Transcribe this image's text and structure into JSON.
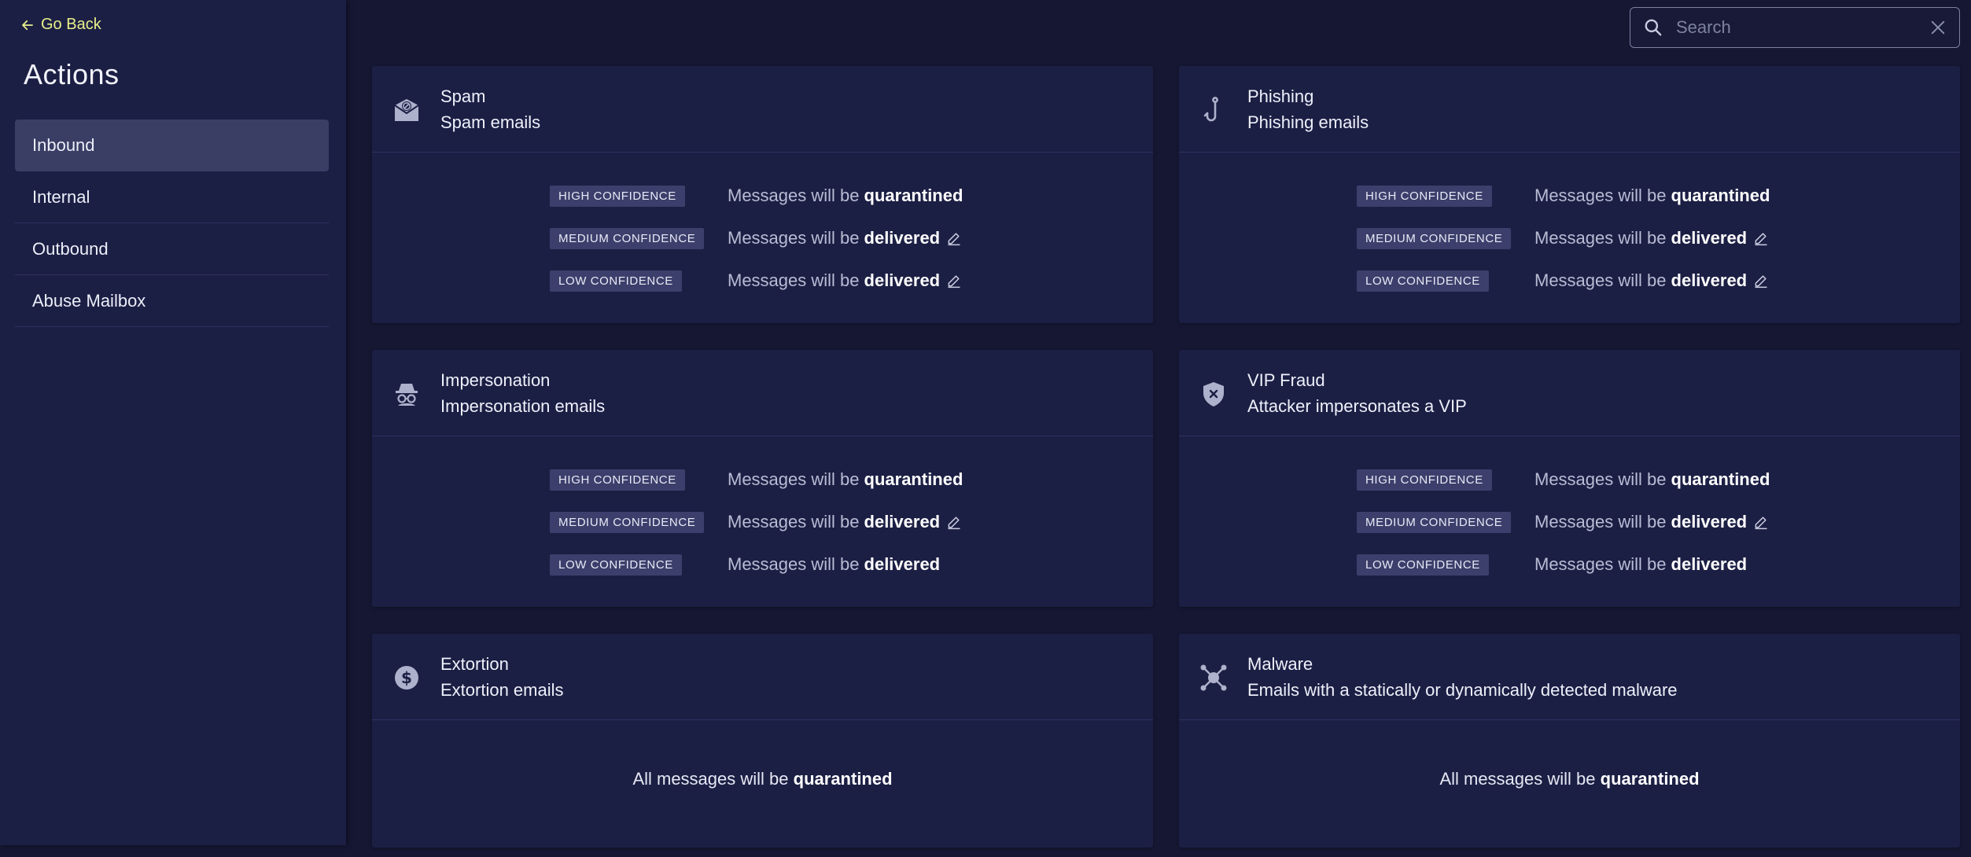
{
  "sidebar": {
    "go_back": "Go Back",
    "title": "Actions",
    "items": [
      {
        "label": "Inbound",
        "active": true
      },
      {
        "label": "Internal",
        "active": false
      },
      {
        "label": "Outbound",
        "active": false
      },
      {
        "label": "Abuse Mailbox",
        "active": false
      }
    ]
  },
  "search": {
    "placeholder": "Search",
    "value": ""
  },
  "colors": {
    "background": "#161733",
    "panel": "#1c1f44",
    "accent": "#e7ef8a",
    "badge": "#3c3f6b"
  },
  "cards": {
    "spam": {
      "icon": "envelope-ban-icon",
      "name": "Spam",
      "subtitle": "Spam emails",
      "rows": [
        {
          "badge": "HIGH CONFIDENCE",
          "prefix": "Messages will be",
          "action": "quarantined",
          "editable": false
        },
        {
          "badge": "MEDIUM CONFIDENCE",
          "prefix": "Messages will be",
          "action": "delivered",
          "editable": true
        },
        {
          "badge": "LOW CONFIDENCE",
          "prefix": "Messages will be",
          "action": "delivered",
          "editable": true
        }
      ]
    },
    "phishing": {
      "icon": "fish-hook-icon",
      "name": "Phishing",
      "subtitle": "Phishing emails",
      "rows": [
        {
          "badge": "HIGH CONFIDENCE",
          "prefix": "Messages will be",
          "action": "quarantined",
          "editable": false
        },
        {
          "badge": "MEDIUM CONFIDENCE",
          "prefix": "Messages will be",
          "action": "delivered",
          "editable": true
        },
        {
          "badge": "LOW CONFIDENCE",
          "prefix": "Messages will be",
          "action": "delivered",
          "editable": true
        }
      ]
    },
    "impersonation": {
      "icon": "incognito-icon",
      "name": "Impersonation",
      "subtitle": "Impersonation emails",
      "rows": [
        {
          "badge": "HIGH CONFIDENCE",
          "prefix": "Messages will be",
          "action": "quarantined",
          "editable": false
        },
        {
          "badge": "MEDIUM CONFIDENCE",
          "prefix": "Messages will be",
          "action": "delivered",
          "editable": true
        },
        {
          "badge": "LOW CONFIDENCE",
          "prefix": "Messages will be",
          "action": "delivered",
          "editable": false
        }
      ]
    },
    "vip_fraud": {
      "icon": "shield-x-icon",
      "name": "VIP Fraud",
      "subtitle": "Attacker impersonates a VIP",
      "rows": [
        {
          "badge": "HIGH CONFIDENCE",
          "prefix": "Messages will be",
          "action": "quarantined",
          "editable": false
        },
        {
          "badge": "MEDIUM CONFIDENCE",
          "prefix": "Messages will be",
          "action": "delivered",
          "editable": true
        },
        {
          "badge": "LOW CONFIDENCE",
          "prefix": "Messages will be",
          "action": "delivered",
          "editable": false
        }
      ]
    },
    "extortion": {
      "icon": "dollar-coin-icon",
      "name": "Extortion",
      "subtitle": "Extortion emails",
      "all_prefix": "All messages will be",
      "all_action": "quarantined"
    },
    "malware": {
      "icon": "virus-icon",
      "name": "Malware",
      "subtitle": "Emails with a statically or dynamically detected malware",
      "all_prefix": "All messages will be",
      "all_action": "quarantined"
    }
  }
}
